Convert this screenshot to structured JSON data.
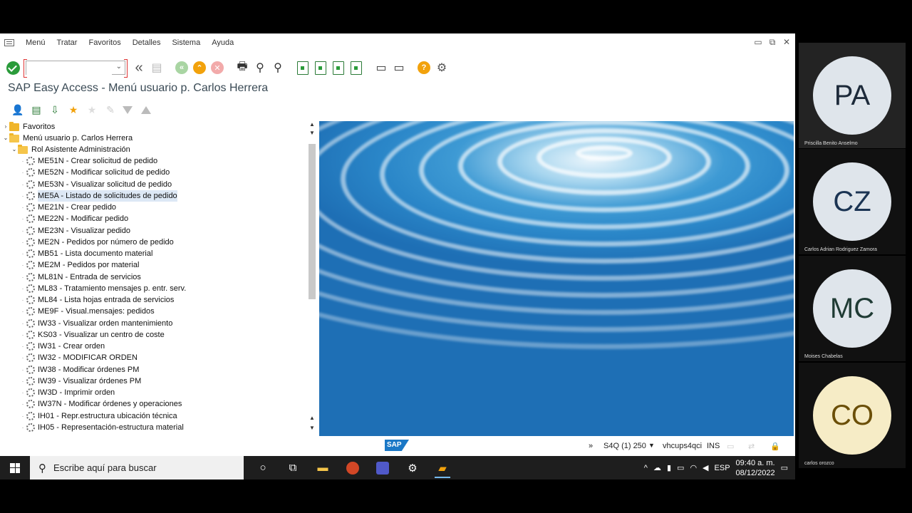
{
  "menubar": {
    "items": [
      "Menú",
      "Tratar",
      "Favoritos",
      "Detalles",
      "Sistema",
      "Ayuda"
    ]
  },
  "window_controls": {
    "minimize": "▭",
    "restore": "⧉",
    "close": "✕"
  },
  "toolbar": {
    "command_value": "",
    "icons": [
      "ok-check-icon",
      "back-double-icon",
      "save-icon",
      "back-icon",
      "exit-icon",
      "cancel-icon",
      "print-icon",
      "find-icon",
      "find-next-icon",
      "first-page-icon",
      "prev-page-icon",
      "next-page-icon",
      "last-page-icon",
      "new-session-icon",
      "shortcut-icon",
      "help-icon",
      "settings-icon"
    ]
  },
  "title": "SAP Easy Access  -  Menú usuario p. Carlos Herrera",
  "tree": {
    "favorites": "Favoritos",
    "user_menu": "Menú usuario p. Carlos Herrera",
    "role": "Rol Asistente Administración",
    "items": [
      "ME51N - Crear solicitud de pedido",
      "ME52N - Modificar solicitud de pedido",
      "ME53N - Visualizar solicitud de pedido",
      "ME5A - Listado de solicitudes de pedido",
      "ME21N - Crear pedido",
      "ME22N - Modificar pedido",
      "ME23N - Visualizar pedido",
      "ME2N - Pedidos por número de pedido",
      "MB51 - Lista documento material",
      "ME2M - Pedidos por material",
      "ML81N - Entrada de servicios",
      "ML83 - Tratamiento mensajes p. entr. serv.",
      "ML84 - Lista hojas entrada de servicios",
      "ME9F - Visual.mensajes: pedidos",
      "IW33 - Visualizar orden mantenimiento",
      "KS03 - Visualizar un centro de coste",
      "IW31 - Crear orden",
      "IW32 - MODIFICAR ORDEN",
      "IW38 - Modificar órdenes PM",
      "IW39 - Visualizar órdenes PM",
      "IW3D - Imprimir orden",
      "IW37N - Modificar órdenes y operaciones",
      "IH01 - Repr.estructura ubicación técnica",
      "IH05 - Representación-estructura material"
    ],
    "selected_index": 3
  },
  "statusbar": {
    "logo": "SAP",
    "more": "»",
    "system": "S4Q (1) 250",
    "dropdown": "▼",
    "server": "vhcups4qci",
    "mode": "INS"
  },
  "taskbar": {
    "search_placeholder": "Escribe aquí para buscar",
    "language": "ESP",
    "time": "09:40 a. m.",
    "date": "08/12/2022"
  },
  "participants": [
    {
      "initials": "PA",
      "name": "Priscilla Benito Anselmo",
      "bg": "#dfe5eb",
      "fg": "#1d2a3a"
    },
    {
      "initials": "CZ",
      "name": "Carlos Adrian Rodriguez Zamora",
      "bg": "#dfe5eb",
      "fg": "#1b3453"
    },
    {
      "initials": "MC",
      "name": "Moises Chabelas",
      "bg": "#dfe5eb",
      "fg": "#1f3b34"
    },
    {
      "initials": "CO",
      "name": "carlos orozco",
      "bg": "#f6ecc6",
      "fg": "#6b4f08"
    }
  ],
  "colors": {
    "sap_blue": "#1b78c6",
    "ok_green": "#2a9b3a",
    "accent_orange": "#f2a20c",
    "folder": "#f0b52a"
  }
}
